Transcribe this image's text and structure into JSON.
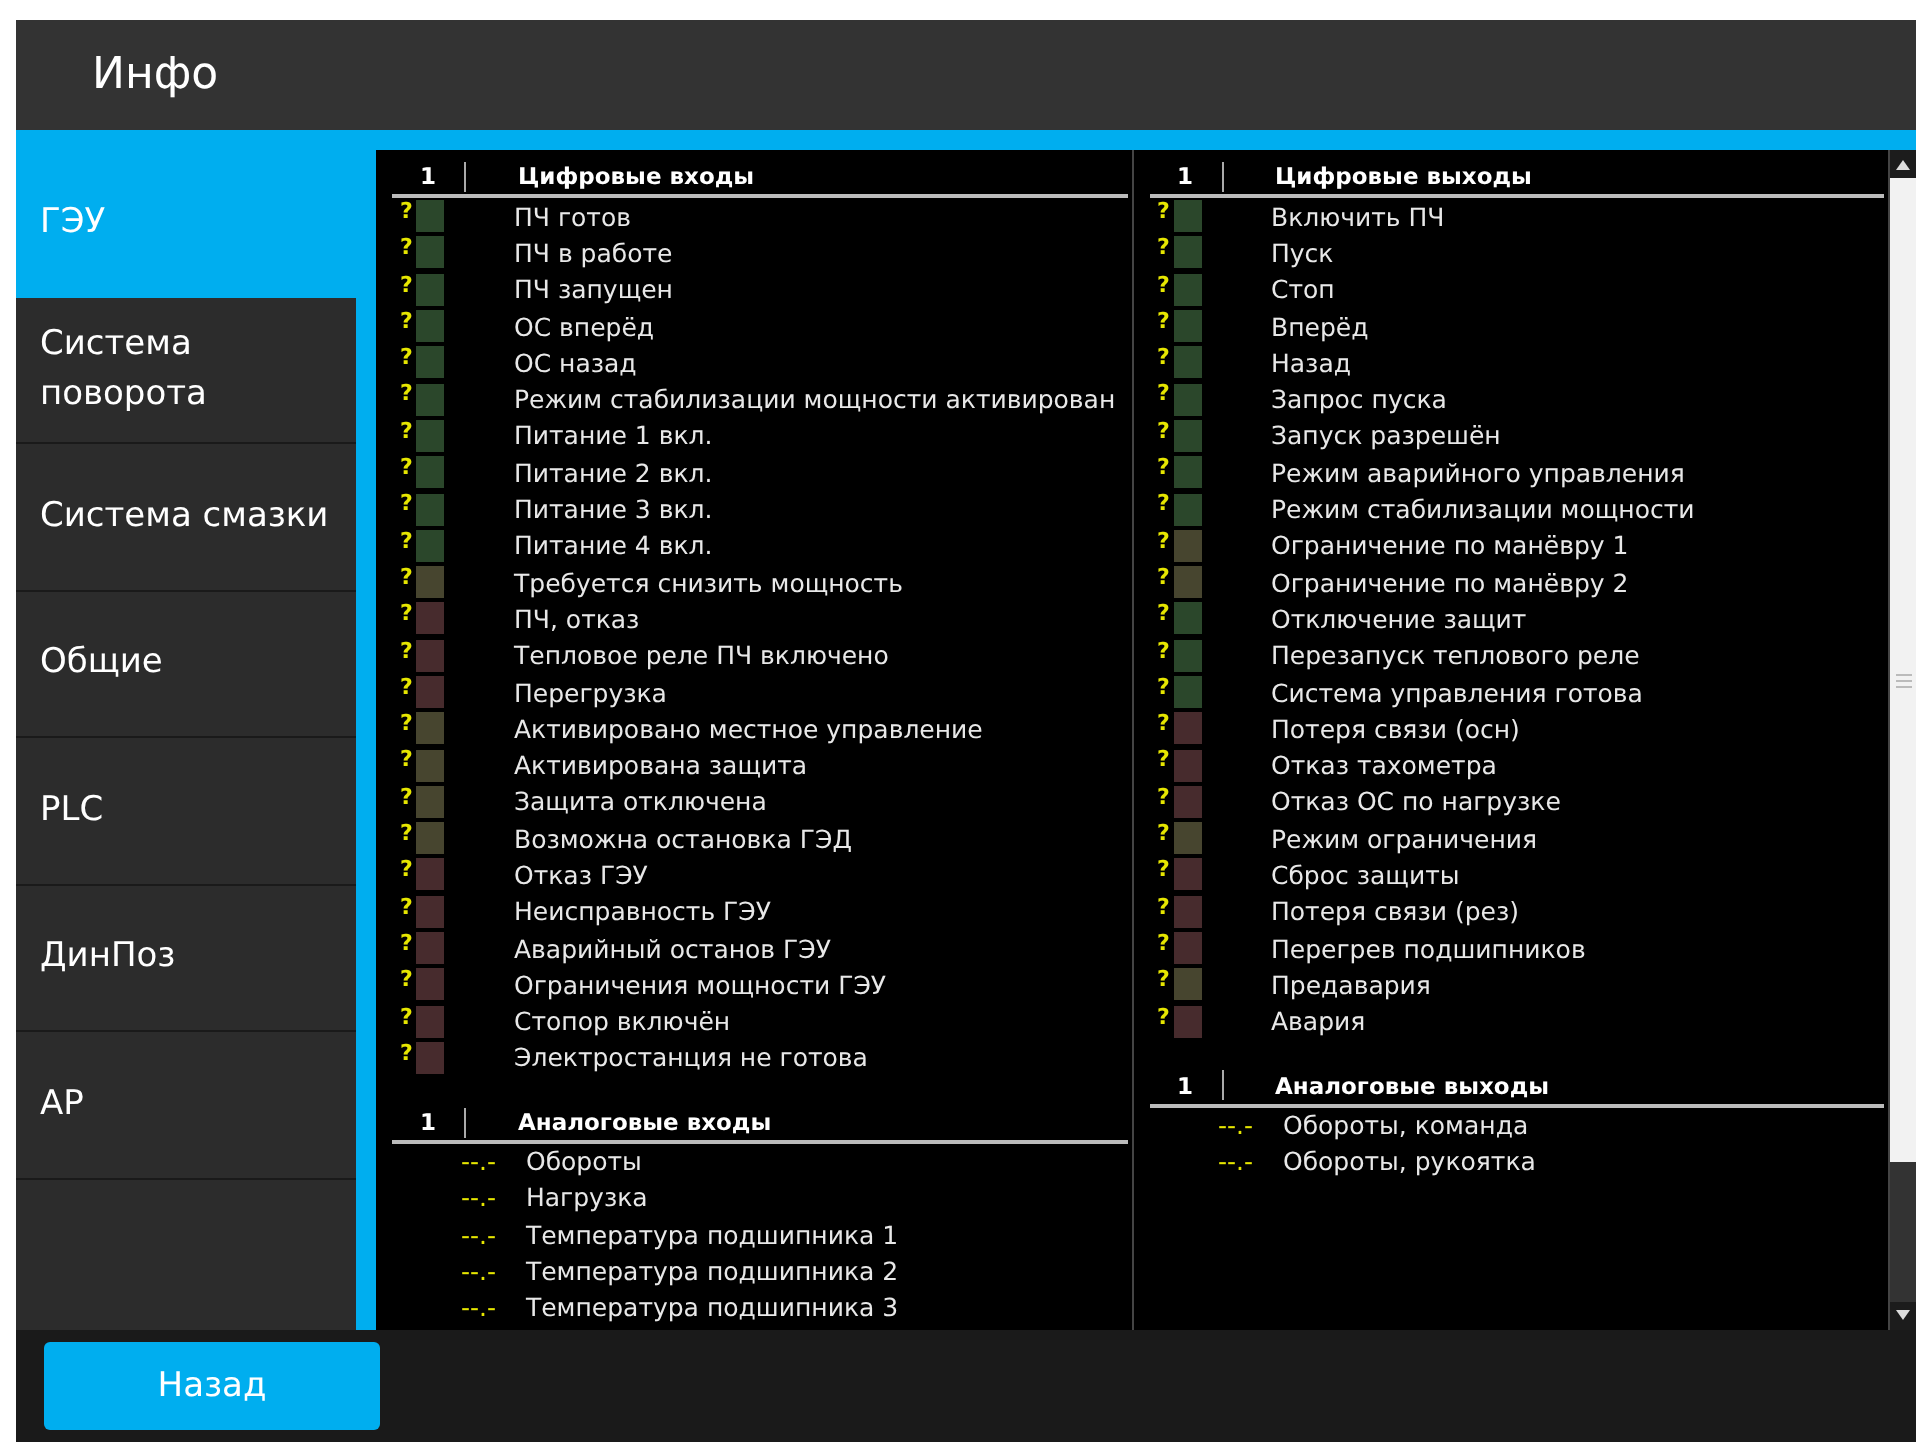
{
  "window": {
    "title": "Инфо"
  },
  "sidebar": {
    "items": [
      {
        "label": "ГЭУ",
        "selected": true
      },
      {
        "label": "Система поворота",
        "selected": false
      },
      {
        "label": "Система смазки",
        "selected": false
      },
      {
        "label": "Общие",
        "selected": false
      },
      {
        "label": "PLC",
        "selected": false
      },
      {
        "label": "ДинПоз",
        "selected": false
      },
      {
        "label": "АР",
        "selected": false
      }
    ]
  },
  "panels": [
    {
      "sections": [
        {
          "kind": "digital",
          "index": "1",
          "title": "Цифровые входы",
          "rows": [
            {
              "mark": "?",
              "label": "ПЧ готов",
              "color": "#2b472b"
            },
            {
              "mark": "?",
              "label": "ПЧ в работе",
              "color": "#2b472b"
            },
            {
              "mark": "?",
              "label": "ПЧ запущен",
              "color": "#2b472b"
            },
            {
              "mark": "?",
              "label": "ОС вперёд",
              "color": "#2b472b"
            },
            {
              "mark": "?",
              "label": "ОС назад",
              "color": "#2b472b"
            },
            {
              "mark": "?",
              "label": "Режим стабилизации мощности активирован",
              "color": "#2b472b"
            },
            {
              "mark": "?",
              "label": "Питание 1 вкл.",
              "color": "#2b472b"
            },
            {
              "mark": "?",
              "label": "Питание 2 вкл.",
              "color": "#2b472b"
            },
            {
              "mark": "?",
              "label": "Питание 3 вкл.",
              "color": "#2b472b"
            },
            {
              "mark": "?",
              "label": "Питание 4 вкл.",
              "color": "#2b472b"
            },
            {
              "mark": "?",
              "label": "Требуется снизить мощность",
              "color": "#47452f"
            },
            {
              "mark": "?",
              "label": "ПЧ, отказ",
              "color": "#472b2d"
            },
            {
              "mark": "?",
              "label": "Тепловое реле ПЧ включено",
              "color": "#472b2d"
            },
            {
              "mark": "?",
              "label": "Перегрузка",
              "color": "#472b2d"
            },
            {
              "mark": "?",
              "label": "Активировано местное управление",
              "color": "#47452f"
            },
            {
              "mark": "?",
              "label": "Активирована защита",
              "color": "#47452f"
            },
            {
              "mark": "?",
              "label": "Защита отключена",
              "color": "#47452f"
            },
            {
              "mark": "?",
              "label": "Возможна остановка ГЭД",
              "color": "#47452f"
            },
            {
              "mark": "?",
              "label": "Отказ ГЭУ",
              "color": "#472b2d"
            },
            {
              "mark": "?",
              "label": "Неисправность ГЭУ",
              "color": "#472b2d"
            },
            {
              "mark": "?",
              "label": "Аварийный останов ГЭУ",
              "color": "#472b2d"
            },
            {
              "mark": "?",
              "label": "Ограничения мощности ГЭУ",
              "color": "#472b2d"
            },
            {
              "mark": "?",
              "label": "Стопор включён",
              "color": "#472b2d"
            },
            {
              "mark": "?",
              "label": "Электростанция не готова",
              "color": "#472b2d"
            }
          ]
        },
        {
          "kind": "analog",
          "index": "1",
          "title": "Аналоговые входы",
          "rows": [
            {
              "value": "--.-",
              "label": "Обороты"
            },
            {
              "value": "--.-",
              "label": "Нагрузка"
            },
            {
              "value": "--.-",
              "label": "Температура подшипника 1"
            },
            {
              "value": "--.-",
              "label": "Температура подшипника 2"
            },
            {
              "value": "--.-",
              "label": "Температура подшипника 3"
            }
          ]
        }
      ]
    },
    {
      "sections": [
        {
          "kind": "digital",
          "index": "1",
          "title": "Цифровые выходы",
          "rows": [
            {
              "mark": "?",
              "label": "Включить ПЧ",
              "color": "#2b472b"
            },
            {
              "mark": "?",
              "label": "Пуск",
              "color": "#2b472b"
            },
            {
              "mark": "?",
              "label": "Стоп",
              "color": "#2b472b"
            },
            {
              "mark": "?",
              "label": "Вперёд",
              "color": "#2b472b"
            },
            {
              "mark": "?",
              "label": "Назад",
              "color": "#2b472b"
            },
            {
              "mark": "?",
              "label": "Запрос пуска",
              "color": "#2b472b"
            },
            {
              "mark": "?",
              "label": "Запуск разрешён",
              "color": "#2b472b"
            },
            {
              "mark": "?",
              "label": "Режим аварийного управления",
              "color": "#2b472b"
            },
            {
              "mark": "?",
              "label": "Режим стабилизации мощности",
              "color": "#2b472b"
            },
            {
              "mark": "?",
              "label": "Ограничение по манёвру 1",
              "color": "#47452f"
            },
            {
              "mark": "?",
              "label": "Ограничение по манёвру 2",
              "color": "#47452f"
            },
            {
              "mark": "?",
              "label": "Отключение защит",
              "color": "#2b472b"
            },
            {
              "mark": "?",
              "label": "Перезапуск теплового реле",
              "color": "#2b472b"
            },
            {
              "mark": "?",
              "label": "Система управления готова",
              "color": "#2b472b"
            },
            {
              "mark": "?",
              "label": "Потеря связи (осн)",
              "color": "#472b2d"
            },
            {
              "mark": "?",
              "label": "Отказ тахометра",
              "color": "#472b2d"
            },
            {
              "mark": "?",
              "label": "Отказ ОС по нагрузке",
              "color": "#472b2d"
            },
            {
              "mark": "?",
              "label": "Режим ограничения",
              "color": "#47452f"
            },
            {
              "mark": "?",
              "label": "Сброс защиты",
              "color": "#472b2d"
            },
            {
              "mark": "?",
              "label": "Потеря связи (рез)",
              "color": "#472b2d"
            },
            {
              "mark": "?",
              "label": "Перегрев подшипников",
              "color": "#472b2d"
            },
            {
              "mark": "?",
              "label": "Предавария",
              "color": "#47452f"
            },
            {
              "mark": "?",
              "label": "Авария",
              "color": "#472b2d"
            }
          ]
        },
        {
          "kind": "analog",
          "index": "1",
          "title": "Аналоговые выходы",
          "rows": [
            {
              "value": "--.-",
              "label": "Обороты, команда"
            },
            {
              "value": "--.-",
              "label": "Обороты, рукоятка"
            }
          ]
        }
      ]
    }
  ],
  "footer": {
    "back_button": "Назад"
  }
}
